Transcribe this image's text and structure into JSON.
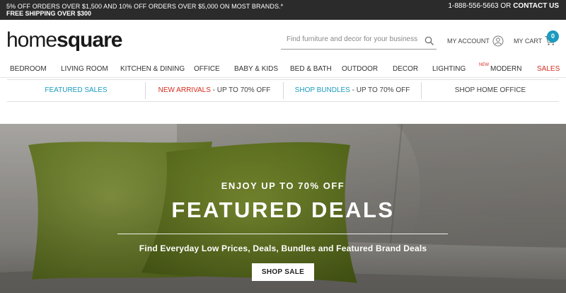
{
  "promo_bar": {
    "line1": "5% OFF ORDERS OVER $1,500 AND 10% OFF ORDERS OVER $5,000 ON MOST BRANDS.*",
    "line2": "FREE SHIPPING OVER $300",
    "phone": "1-888-556-5663",
    "or_text": "OR",
    "contact_label": "CONTACT US"
  },
  "header": {
    "logo_part1": "home",
    "logo_part2": "square",
    "search_placeholder": "Find furniture and decor for your business",
    "account_label": "MY ACCOUNT",
    "cart_label": "MY CART",
    "cart_count": "0",
    "accent_color": "#1a9bbf"
  },
  "category_nav": {
    "items": [
      {
        "label": "BEDROOM"
      },
      {
        "label": "LIVING ROOM"
      },
      {
        "label": "KITCHEN & DINING"
      },
      {
        "label": "OFFICE"
      },
      {
        "label": "BABY & KIDS"
      },
      {
        "label": "BED & BATH"
      },
      {
        "label": "OUTDOOR"
      },
      {
        "label": "DECOR"
      },
      {
        "label": "LIGHTING"
      },
      {
        "label": "MODERN",
        "badge": "NEW"
      },
      {
        "label": "SALES"
      }
    ]
  },
  "promo_links": [
    {
      "main": "FEATURED SALES",
      "suffix": ""
    },
    {
      "main": "NEW ARRIVALS",
      "suffix": " - UP TO 70% OFF"
    },
    {
      "main": "SHOP BUNDLES",
      "suffix": " - UP TO 70% OFF"
    },
    {
      "main": "SHOP HOME OFFICE",
      "suffix": ""
    }
  ],
  "hero": {
    "subtitle": "ENJOY UP TO 70% OFF",
    "title": "FEATURED DEALS",
    "description": "Find Everyday Low Prices, Deals, Bundles and Featured Brand Deals",
    "button_label": "SHOP SALE"
  }
}
